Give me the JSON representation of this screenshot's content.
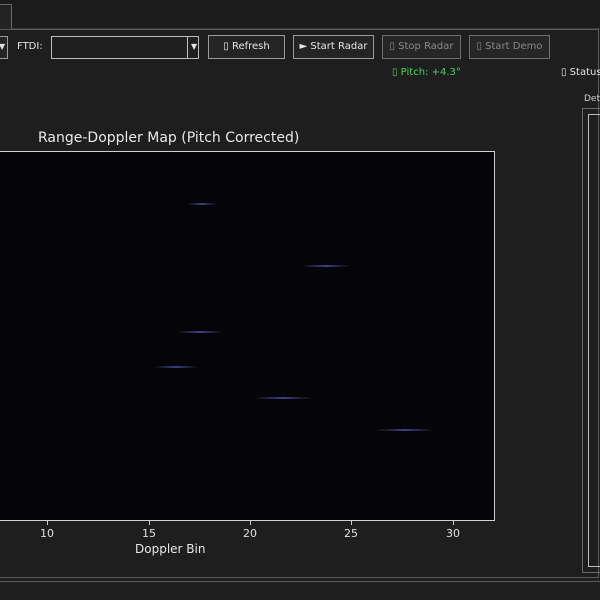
{
  "toolbar": {
    "ftdi_label": "FTDI:",
    "ftdi_value": "",
    "refresh_label": "▯ Refresh",
    "start_radar_label": "► Start Radar",
    "stop_radar_label": "▯ Stop Radar",
    "start_demo_label": "▯ Start Demo"
  },
  "status_row": {
    "pitch_text": "▯ Pitch: +4.3°",
    "status_text": "▯ Status:"
  },
  "detections_panel": {
    "title": "Det"
  },
  "plot": {
    "title": "Range-Doppler Map (Pitch Corrected)",
    "xlabel": "Doppler Bin",
    "x_ticks": [
      "10",
      "15",
      "20",
      "25",
      "30"
    ]
  },
  "colors": {
    "background": "#1e1e1e",
    "plot_background": "#050508",
    "pitch_text": "#46d35c",
    "button_border": "#9a9a9a",
    "disabled_text": "#8a8a8a"
  }
}
